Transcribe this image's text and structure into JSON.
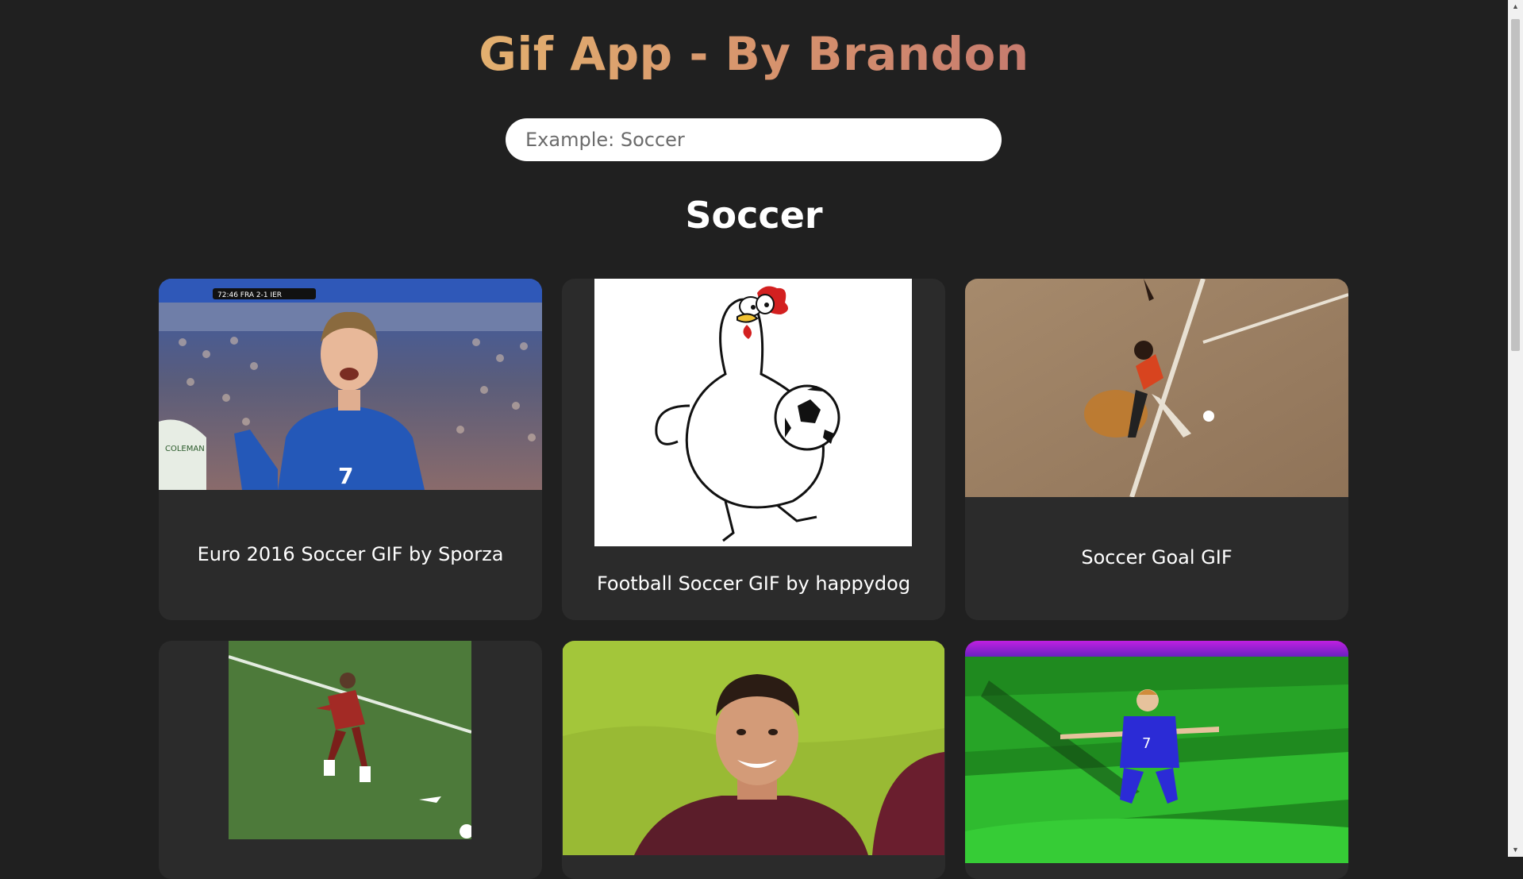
{
  "header": {
    "title": "Gif App - By Brandon"
  },
  "search": {
    "placeholder": "Example: Soccer",
    "value": ""
  },
  "section": {
    "title": "Soccer"
  },
  "gifs": [
    {
      "caption": "Euro 2016 Soccer GIF by Sporza"
    },
    {
      "caption": "Football Soccer GIF by happydog"
    },
    {
      "caption": "Soccer Goal GIF"
    },
    {
      "caption": ""
    },
    {
      "caption": ""
    },
    {
      "caption": ""
    }
  ],
  "overlays": {
    "scoreboard": "72:46  FRA  2-1  IER",
    "jersey_number": "7",
    "player_name": "COLEMAN"
  },
  "colors": {
    "background": "#202020",
    "card": "#2b2b2b",
    "title_gradient_start": "#e3b06f",
    "title_gradient_end": "#c77b6e",
    "text": "#ffffff"
  },
  "icons": {
    "scroll_up": "scroll-up-arrow-icon",
    "scroll_down": "scroll-down-arrow-icon"
  }
}
